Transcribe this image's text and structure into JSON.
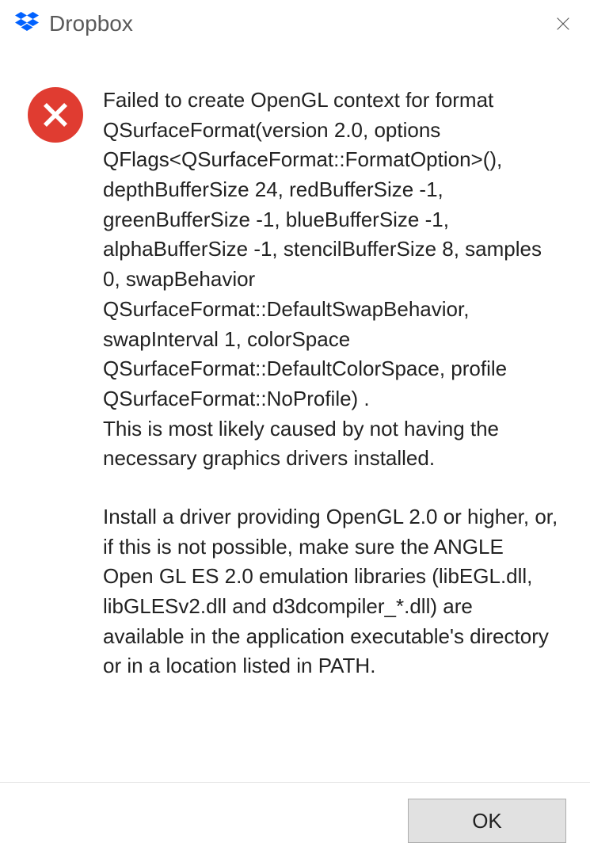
{
  "titlebar": {
    "app_name": "Dropbox"
  },
  "dialog": {
    "message_p1": "Failed to create OpenGL context for format QSurfaceFormat(version 2.0, options QFlags<QSurfaceFormat::FormatOption>(), depthBufferSize 24, redBufferSize -1, greenBufferSize -1, blueBufferSize -1, alphaBufferSize -1, stencilBufferSize 8, samples 0, swapBehavior QSurfaceFormat::DefaultSwapBehavior, swapInterval 1, colorSpace QSurfaceFormat::DefaultColorSpace, profile  QSurfaceFormat::NoProfile) .\nThis is most likely caused by not having the necessary graphics drivers installed.",
    "message_p2": "Install a driver providing OpenGL 2.0 or higher, or, if this is not possible, make sure the ANGLE Open GL ES 2.0 emulation libraries (libEGL.dll, libGLESv2.dll and d3dcompiler_*.dll) are available in the application executable's directory or in a location listed in PATH."
  },
  "buttons": {
    "ok": "OK"
  },
  "colors": {
    "dropbox_blue": "#0061ff",
    "error_red": "#e03c31"
  }
}
